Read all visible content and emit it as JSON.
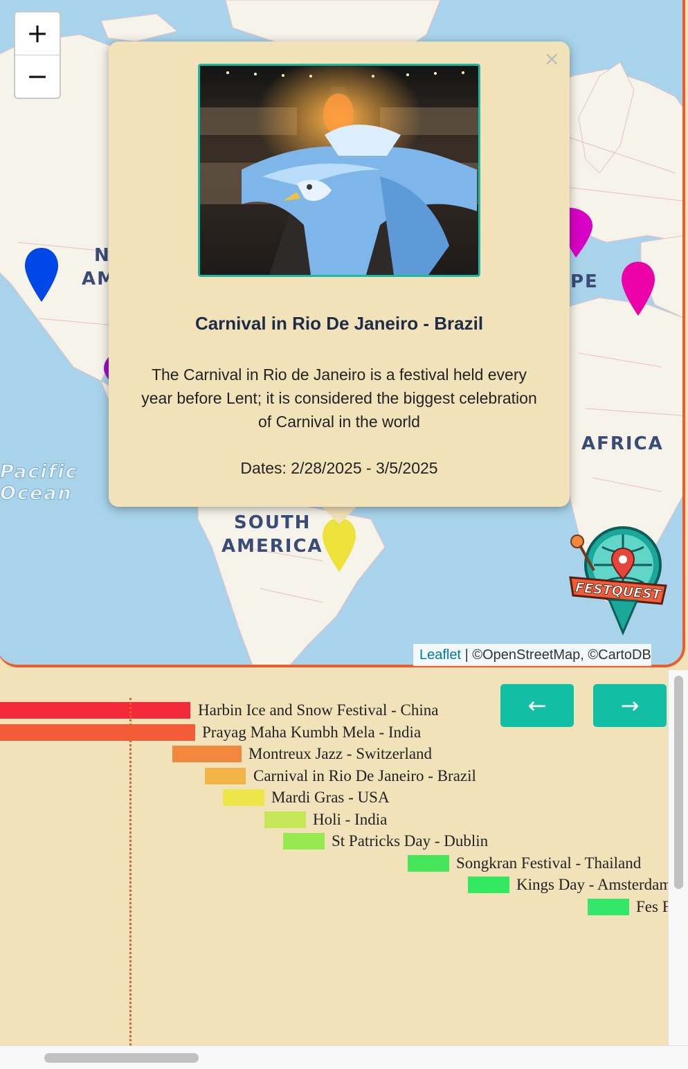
{
  "map": {
    "zoom_in": "+",
    "zoom_out": "−",
    "region_labels": {
      "north_america_1": "N",
      "north_america_2": "AM",
      "europe_fragment": "PE",
      "africa": "AFRICA",
      "south_america_1": "SOUTH",
      "south_america_2": "AMERICA"
    },
    "ocean_labels": {
      "pacific_1": "Pacific",
      "pacific_2": "Ocean"
    },
    "markers": [
      {
        "color": "#0047e8"
      },
      {
        "color": "#d800c4"
      },
      {
        "color": "#ec00a8"
      },
      {
        "color": "#a010c8"
      },
      {
        "color": "#ece23a"
      }
    ],
    "attribution": {
      "leaflet": "Leaflet",
      "separator": " | ",
      "credits": "©OpenStreetMap, ©CartoDB"
    }
  },
  "popup": {
    "close": "×",
    "image_icon": "carnival-parade-photo",
    "title": "Carnival in Rio De Janeiro - Brazil",
    "description": "The Carnival in Rio de Janeiro is a festival held every year before Lent; it is considered the biggest celebration of Carnival in the world",
    "dates": "Dates: 2/28/2025 - 3/5/2025"
  },
  "logo": {
    "text": "FESTQUEST"
  },
  "timeline": {
    "prev": "←",
    "next": "→",
    "events": [
      {
        "label": "Harbin Ice and Snow Festival - China",
        "color": "#f22a3a"
      },
      {
        "label": "Prayag Maha Kumbh Mela - India",
        "color": "#f25c38"
      },
      {
        "label": "Montreux Jazz - Switzerland",
        "color": "#f2873e"
      },
      {
        "label": "Carnival in Rio De Janeiro - Brazil",
        "color": "#f2b446"
      },
      {
        "label": "Mardi Gras - USA",
        "color": "#ece64a"
      },
      {
        "label": "Holi - India",
        "color": "#c4e855"
      },
      {
        "label": "St Patricks Day - Dublin",
        "color": "#96ea50"
      },
      {
        "label": "Songkran Festival - Thailand",
        "color": "#45e65a"
      },
      {
        "label": "Kings Day - Amsterdam",
        "color": "#33e85e"
      },
      {
        "label": "Fes F",
        "color": "#33e868"
      }
    ]
  }
}
